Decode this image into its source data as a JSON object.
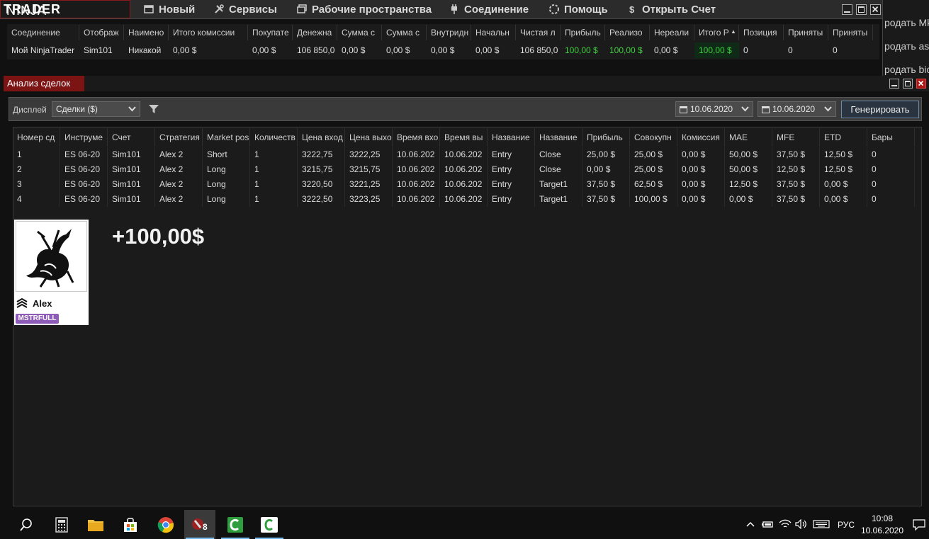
{
  "app": {
    "logo_light": "NINJA",
    "logo_bold": "TRADER",
    "menu": [
      "Новый",
      "Сервисы",
      "Рабочие пространства",
      "Соединение",
      "Помощь",
      "Открыть Счет"
    ]
  },
  "right_sliver": [
    "родать Mk",
    "родать as",
    "родать bic"
  ],
  "accounts": {
    "columns": [
      "Соединение",
      "Отображ",
      "Наимено",
      "Итого комиссии",
      "Покупате",
      "Денежна",
      "Сумма с",
      "Сумма с",
      "Внутридн",
      "Начальн",
      "Чистая л",
      "Прибыль",
      "Реализо",
      "Нереали",
      "Итого Р",
      "Позиция",
      "Приняты",
      "Приняты"
    ],
    "row": [
      "Мой NinjaTrader",
      "Sim101",
      "Никакой",
      "0,00 $",
      "0,00 $",
      "106 850,0",
      "0,00 $",
      "0,00 $",
      "0,00 $",
      "0,00 $",
      "106 850,0",
      "100,00 $",
      "100,00 $",
      "0,00 $",
      "100,00 $",
      "0",
      "0",
      "0"
    ],
    "sort_indicator": "▲"
  },
  "analysis": {
    "title": "Анализ сделок",
    "display_label": "Дисплей",
    "display_value": "Сделки ($)",
    "date_from": "10.06.2020",
    "date_to": "10.06.2020",
    "generate_label": "Генерировать",
    "columns": [
      "Номер сд",
      "Инструме",
      "Счет",
      "Стратегия",
      "Market pos",
      "Количеств",
      "Цена вход",
      "Цена выхо",
      "Время вхо",
      "Время вы",
      "Название",
      "Название",
      "Прибыль",
      "Совокупн",
      "Комиссия",
      "MAE",
      "MFE",
      "ETD",
      "Бары"
    ],
    "rows": [
      [
        "1",
        "ES 06-20",
        "Sim101",
        "Alex 2",
        "Short",
        "1",
        "3222,75",
        "3222,25",
        "10.06.202",
        "10.06.202",
        "Entry",
        "Close",
        "25,00 $",
        "25,00 $",
        "0,00 $",
        "50,00 $",
        "37,50 $",
        "12,50 $",
        "0"
      ],
      [
        "2",
        "ES 06-20",
        "Sim101",
        "Alex 2",
        "Long",
        "1",
        "3215,75",
        "3215,75",
        "10.06.202",
        "10.06.202",
        "Entry",
        "Close",
        "0,00 $",
        "25,00 $",
        "0,00 $",
        "50,00 $",
        "12,50 $",
        "12,50 $",
        "0"
      ],
      [
        "3",
        "ES 06-20",
        "Sim101",
        "Alex 2",
        "Long",
        "1",
        "3220,50",
        "3221,25",
        "10.06.202",
        "10.06.202",
        "Entry",
        "Target1",
        "37,50 $",
        "62,50 $",
        "0,00 $",
        "12,50 $",
        "37,50 $",
        "0,00 $",
        "0"
      ],
      [
        "4",
        "ES 06-20",
        "Sim101",
        "Alex 2",
        "Long",
        "1",
        "3222,50",
        "3223,25",
        "10.06.202",
        "10.06.202",
        "Entry",
        "Target1",
        "37,50 $",
        "100,00 $",
        "0,00 $",
        "0,00 $",
        "37,50 $",
        "0,00 $",
        "0"
      ]
    ]
  },
  "profile": {
    "name": "Alex",
    "badge": "MSTRFULL"
  },
  "overlay_total": "+100,00$",
  "taskbar": {
    "badge_count": "8",
    "lang": "РУС",
    "time": "10:08",
    "date": "10.06.2020"
  },
  "colors": {
    "accent_red": "#7d1414",
    "profit_green": "#3fd13f",
    "badge_purple": "#8e5bb8"
  }
}
